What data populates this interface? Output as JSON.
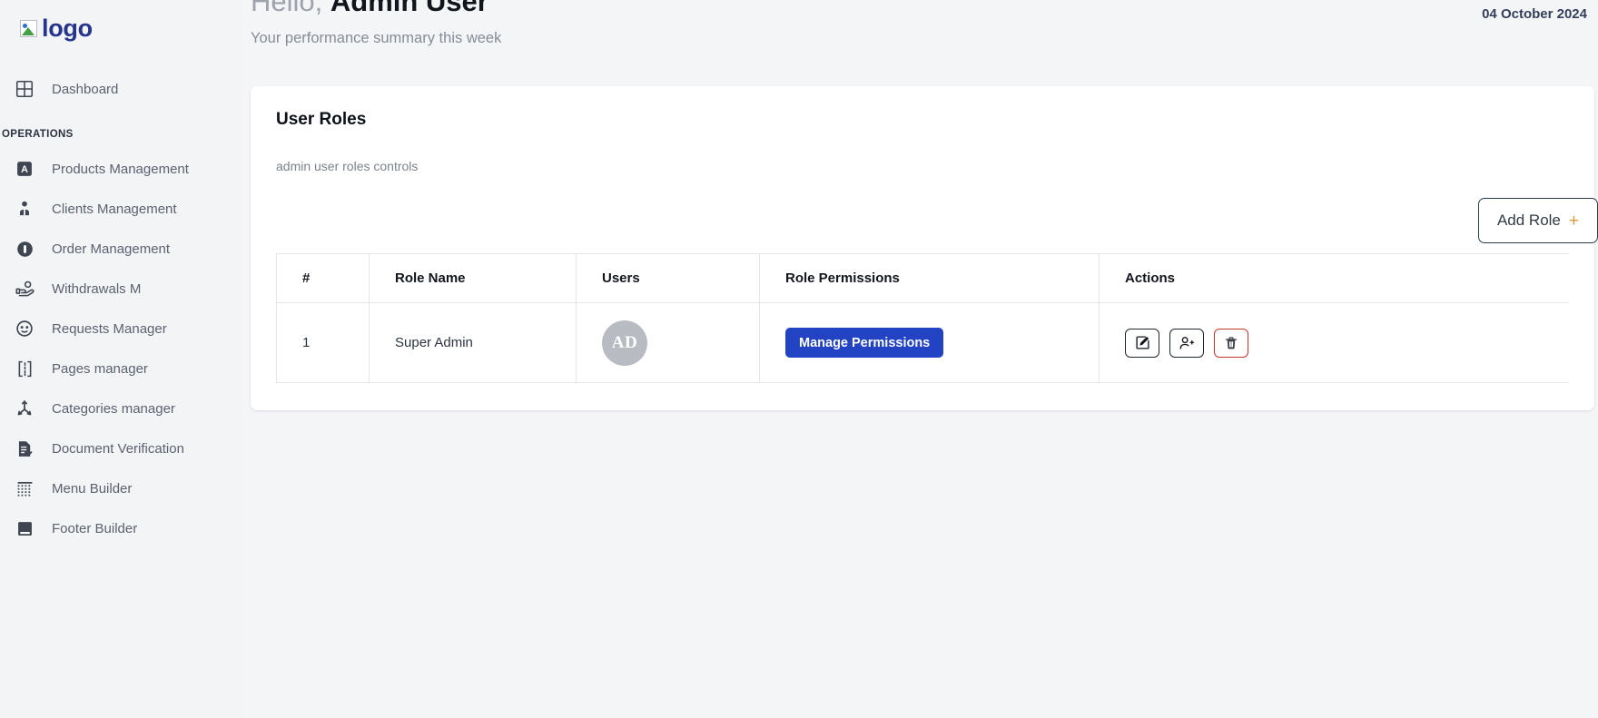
{
  "sidebar": {
    "logo": {
      "alt_text": "logo",
      "icon": "broken-image-icon"
    },
    "top_items": [
      {
        "label": "Dashboard",
        "icon": "grid-dashboard-icon"
      }
    ],
    "section_label": "OPERATIONS",
    "items": [
      {
        "label": "Products Management",
        "icon": "box-archive-icon"
      },
      {
        "label": "Clients Management",
        "icon": "user-tie-icon"
      },
      {
        "label": "Order Management",
        "icon": "circle-order-icon"
      },
      {
        "label": "Withdrawals M",
        "icon": "hand-coin-icon"
      },
      {
        "label": "Requests Manager",
        "icon": "face-support-icon"
      },
      {
        "label": "Pages manager",
        "icon": "page-brackets-icon"
      },
      {
        "label": "Categories manager",
        "icon": "hierarchy-branch-icon"
      },
      {
        "label": "Document Verification",
        "icon": "document-check-icon"
      },
      {
        "label": "Menu Builder",
        "icon": "dotted-grid-icon"
      },
      {
        "label": "Footer Builder",
        "icon": "footer-block-icon"
      }
    ]
  },
  "header": {
    "greeting_prefix": "Hello, ",
    "user_name": "Admin User",
    "subtitle": "Your performance summary this week",
    "date": "04 October 2024"
  },
  "card": {
    "title": "User Roles",
    "description": "admin user roles controls",
    "add_button": {
      "label": "Add Role",
      "plus": "+"
    }
  },
  "table": {
    "columns": [
      "#",
      "Role Name",
      "Users",
      "Role Permissions",
      "Actions"
    ],
    "rows": [
      {
        "number": "1",
        "role_name": "Super Admin",
        "user_initials": "AD",
        "permissions_label": "Manage Permissions",
        "actions": [
          "edit-icon",
          "add-user-icon",
          "delete-icon"
        ]
      }
    ]
  },
  "colors": {
    "accent_blue": "#2243c4",
    "logo_navy": "#26348b",
    "danger_red": "#c0392b",
    "plus_orange": "#d79a3c",
    "avatar_gray": "#b8bcc2",
    "page_bg": "#f4f5f7",
    "sidebar_bg": "#f3f4f6"
  }
}
